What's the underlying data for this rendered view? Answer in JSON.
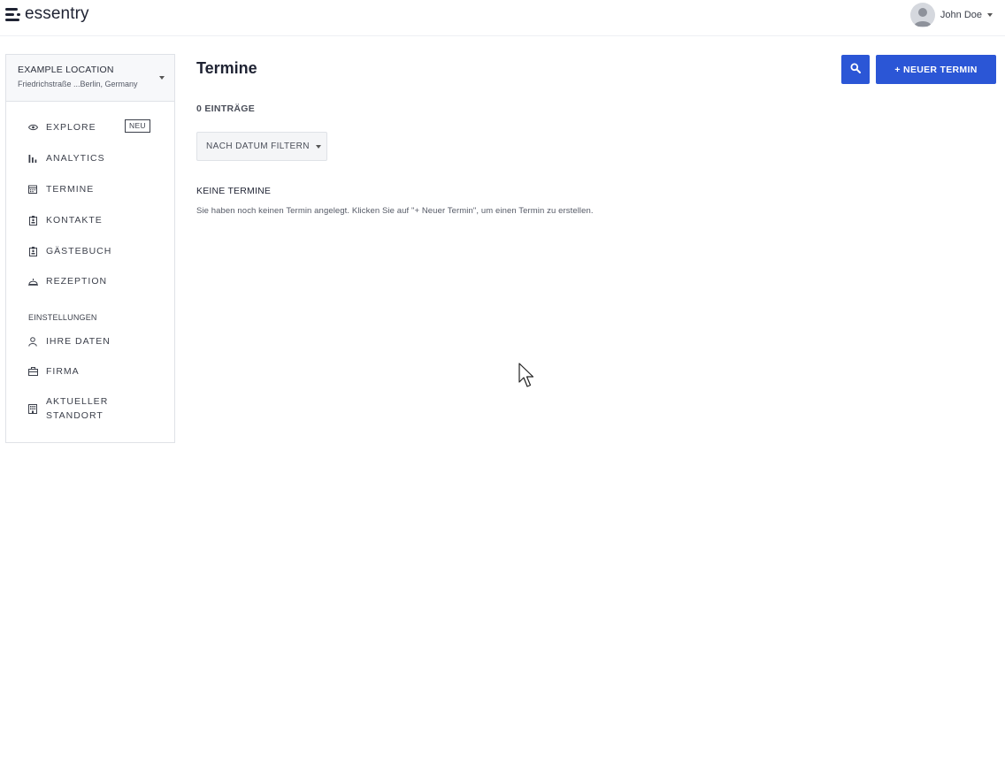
{
  "header": {
    "logo_text": "essentry",
    "user_name": "John Doe"
  },
  "location": {
    "name": "EXAMPLE LOCATION",
    "address": "Friedrichstraße ...Berlin, Germany"
  },
  "sidebar": {
    "items": [
      {
        "label": "EXPLORE",
        "icon": "eye-icon",
        "badge": "NEU"
      },
      {
        "label": "ANALYTICS",
        "icon": "bar-chart-icon"
      },
      {
        "label": "TERMINE",
        "icon": "calendar-icon"
      },
      {
        "label": "KONTAKTE",
        "icon": "contact-badge-icon"
      },
      {
        "label": "GÄSTEBUCH",
        "icon": "guestbook-icon"
      },
      {
        "label": "REZEPTION",
        "icon": "reception-bell-icon"
      }
    ],
    "settings_label": "EINSTELLUNGEN",
    "settings_items": [
      {
        "label": "IHRE DATEN",
        "icon": "person-icon"
      },
      {
        "label": "FIRMA",
        "icon": "briefcase-icon"
      },
      {
        "label_line1": "AKTUELLER",
        "label_line2": "STANDORT",
        "icon": "building-icon"
      }
    ]
  },
  "main": {
    "title": "Termine",
    "new_button_label": "+ NEUER TERMIN",
    "count_label": "0 EINTRÄGE",
    "filter_label": "NACH DATUM FILTERN",
    "empty_title": "KEINE TERMINE",
    "empty_text": "Sie haben noch keinen Termin angelegt. Klicken Sie auf \"+ Neuer Termin\", um einen Termin zu erstellen."
  },
  "colors": {
    "primary": "#2b56d6",
    "text": "#1f2333",
    "border": "#dfe2e7"
  }
}
